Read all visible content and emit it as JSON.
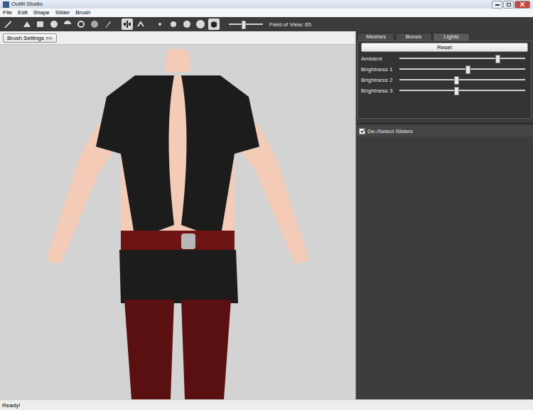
{
  "window": {
    "title": "Outfit Studio"
  },
  "menu": [
    "File",
    "Edit",
    "Shape",
    "Slider",
    "Brush"
  ],
  "toolbar": {
    "tools": [
      {
        "selected": false
      },
      {
        "selected": false
      },
      {
        "selected": false
      },
      {
        "selected": false
      },
      {
        "selected": false
      },
      {
        "selected": false
      },
      {
        "selected": false
      },
      {
        "selected": false
      },
      {
        "selected": true
      },
      {
        "selected": false
      },
      {
        "selected": false
      },
      {
        "selected": false
      },
      {
        "selected": false
      },
      {
        "selected": false
      },
      {
        "selected": true
      }
    ],
    "fov": {
      "label": "Field of View: 65",
      "level": 0.44
    }
  },
  "brush_settings": {
    "label": "Brush Settings >>"
  },
  "tabs": [
    {
      "label": "Meshes",
      "selected": false
    },
    {
      "label": "Bones",
      "selected": false
    },
    {
      "label": "Lights",
      "selected": true
    }
  ],
  "lights": {
    "reset": "Reset",
    "sliders": [
      {
        "label": "Ambient",
        "level": 0.78
      },
      {
        "label": "Brightness 1",
        "level": 0.54
      },
      {
        "label": "Brightness 2",
        "level": 0.45
      },
      {
        "label": "Brightness 3",
        "level": 0.45
      }
    ]
  },
  "sliders_panel": {
    "label": "De-/Select Sliders",
    "checked": true
  },
  "status_bar": "Ready!"
}
